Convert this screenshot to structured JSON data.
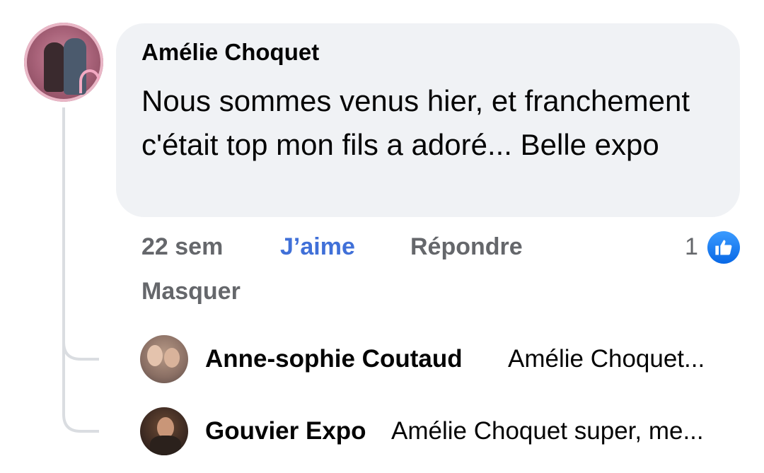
{
  "comment": {
    "author": "Amélie Choquet",
    "text": "Nous sommes venus hier, et franchement c'était top mon fils a adoré... Belle expo",
    "time": "22 sem",
    "like_label": "J’aime",
    "reply_label": "Répondre",
    "hide_label": "Masquer",
    "reaction_count": "1",
    "reaction_icon": "like-icon",
    "colors": {
      "bubble": "#f0f2f5",
      "like_action": "#4070d8",
      "meta_text": "#65676b",
      "reaction_blue": "#1877f2"
    }
  },
  "replies": [
    {
      "name": "Anne-sophie Coutaud",
      "snippet": "Amélie Choquet..."
    },
    {
      "name": "Gouvier Expo",
      "snippet": "Amélie Choquet super, me..."
    }
  ]
}
